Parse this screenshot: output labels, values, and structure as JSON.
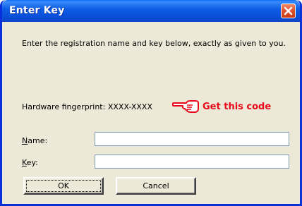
{
  "window": {
    "title": "Enter Key",
    "close_icon": "close-icon"
  },
  "content": {
    "instructions": "Enter the registration name and key below, exactly as given to you.",
    "fingerprint_label": "Hardware fingerprint:",
    "fingerprint_value": "XXXX-XXXX",
    "hint_icon": "pointing-hand-icon",
    "hint_text": "Get this code"
  },
  "form": {
    "name_label_accel": "N",
    "name_label_rest": "ame:",
    "name_value": "",
    "key_label_accel": "K",
    "key_label_rest": "ey:",
    "key_value": ""
  },
  "buttons": {
    "ok": "OK",
    "cancel": "Cancel"
  },
  "colors": {
    "titlebar": "#0a4fd8",
    "dialog_bg": "#ece9d8",
    "hint": "#e8081a",
    "close": "#e0542c"
  }
}
